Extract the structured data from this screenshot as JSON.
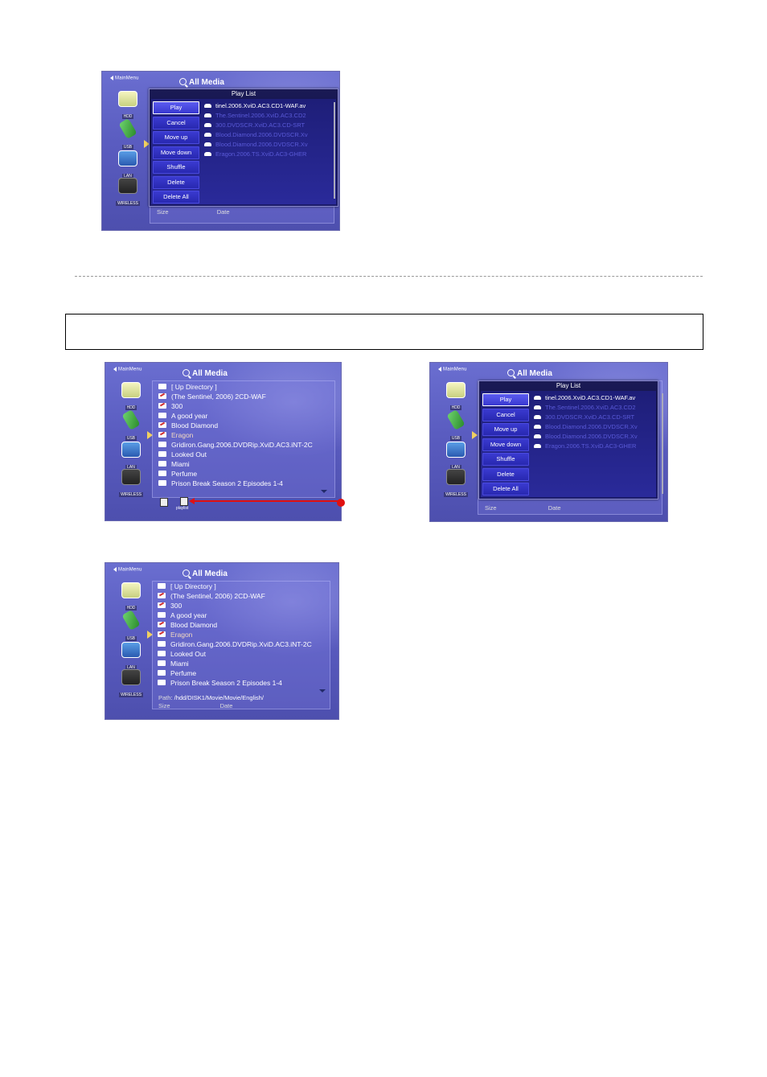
{
  "shared": {
    "main_menu": "MainMenu",
    "title": "All Media",
    "devices": [
      "HDD",
      "USB",
      "LAN",
      "WIRELESS"
    ]
  },
  "playlist": {
    "title": "Play List",
    "menu": [
      "Play",
      "Cancel",
      "Move up",
      "Move down",
      "Shuffle",
      "Delete",
      "Delete All"
    ],
    "items": [
      "tinel.2006.XviD.AC3.CD1-WAF.av",
      "The.Sentinel.2006.XviD.AC3.CD2",
      "300.DVDSCR.XviD.AC3.CD-SRT",
      "Blood.Diamond.2006.DVDSCR.Xv",
      "Blood.Diamond.2006.DVDSCR.Xv",
      "Eragon.2006.TS.XviD.AC3-GHER"
    ],
    "size_label": "Size",
    "date_label": "Date"
  },
  "browser": {
    "files": [
      "[ Up Directory ]",
      "(The Sentinel, 2006) 2CD-WAF",
      "300",
      "A good year",
      "Blood Diamond",
      "Eragon",
      "Gridiron.Gang.2006.DVDRip.XviD.AC3.iNT-2C",
      "Looked Out",
      "Miami",
      "Perfume",
      "Prison Break Season 2 Episodes 1-4"
    ],
    "playlist_label": "playlist",
    "path_label": "Path",
    "path_value": "/hdd/DISK1/Movie/Movie/English/",
    "size_label": "Size",
    "date_label": "Date"
  }
}
